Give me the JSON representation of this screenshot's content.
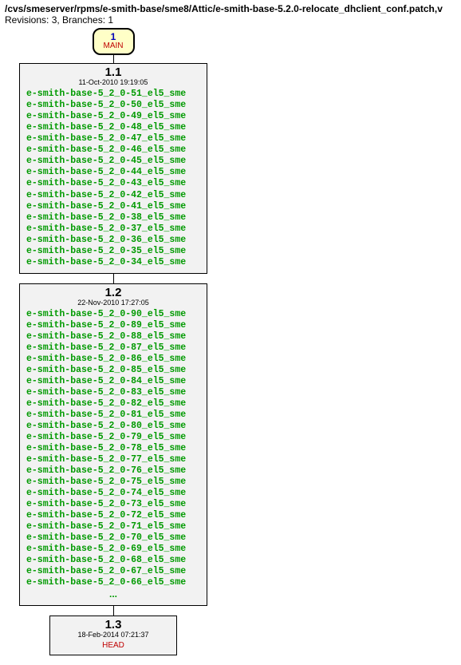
{
  "header": {
    "path": "/cvs/smeserver/rpms/e-smith-base/sme8/Attic/e-smith-base-5.2.0-relocate_dhclient_conf.patch,v",
    "revline": "Revisions: 3, Branches: 1"
  },
  "branch": {
    "number": "1",
    "name": "MAIN"
  },
  "nodes": [
    {
      "rev": "1.1",
      "date": "11-Oct-2010 19:19:05",
      "tags": [
        "e-smith-base-5_2_0-51_el5_sme",
        "e-smith-base-5_2_0-50_el5_sme",
        "e-smith-base-5_2_0-49_el5_sme",
        "e-smith-base-5_2_0-48_el5_sme",
        "e-smith-base-5_2_0-47_el5_sme",
        "e-smith-base-5_2_0-46_el5_sme",
        "e-smith-base-5_2_0-45_el5_sme",
        "e-smith-base-5_2_0-44_el5_sme",
        "e-smith-base-5_2_0-43_el5_sme",
        "e-smith-base-5_2_0-42_el5_sme",
        "e-smith-base-5_2_0-41_el5_sme",
        "e-smith-base-5_2_0-38_el5_sme",
        "e-smith-base-5_2_0-37_el5_sme",
        "e-smith-base-5_2_0-36_el5_sme",
        "e-smith-base-5_2_0-35_el5_sme",
        "e-smith-base-5_2_0-34_el5_sme"
      ],
      "more": "",
      "head": ""
    },
    {
      "rev": "1.2",
      "date": "22-Nov-2010 17:27:05",
      "tags": [
        "e-smith-base-5_2_0-90_el5_sme",
        "e-smith-base-5_2_0-89_el5_sme",
        "e-smith-base-5_2_0-88_el5_sme",
        "e-smith-base-5_2_0-87_el5_sme",
        "e-smith-base-5_2_0-86_el5_sme",
        "e-smith-base-5_2_0-85_el5_sme",
        "e-smith-base-5_2_0-84_el5_sme",
        "e-smith-base-5_2_0-83_el5_sme",
        "e-smith-base-5_2_0-82_el5_sme",
        "e-smith-base-5_2_0-81_el5_sme",
        "e-smith-base-5_2_0-80_el5_sme",
        "e-smith-base-5_2_0-79_el5_sme",
        "e-smith-base-5_2_0-78_el5_sme",
        "e-smith-base-5_2_0-77_el5_sme",
        "e-smith-base-5_2_0-76_el5_sme",
        "e-smith-base-5_2_0-75_el5_sme",
        "e-smith-base-5_2_0-74_el5_sme",
        "e-smith-base-5_2_0-73_el5_sme",
        "e-smith-base-5_2_0-72_el5_sme",
        "e-smith-base-5_2_0-71_el5_sme",
        "e-smith-base-5_2_0-70_el5_sme",
        "e-smith-base-5_2_0-69_el5_sme",
        "e-smith-base-5_2_0-68_el5_sme",
        "e-smith-base-5_2_0-67_el5_sme",
        "e-smith-base-5_2_0-66_el5_sme"
      ],
      "more": "...",
      "head": ""
    },
    {
      "rev": "1.3",
      "date": "18-Feb-2014 07:21:37",
      "tags": [],
      "more": "",
      "head": "HEAD"
    }
  ]
}
